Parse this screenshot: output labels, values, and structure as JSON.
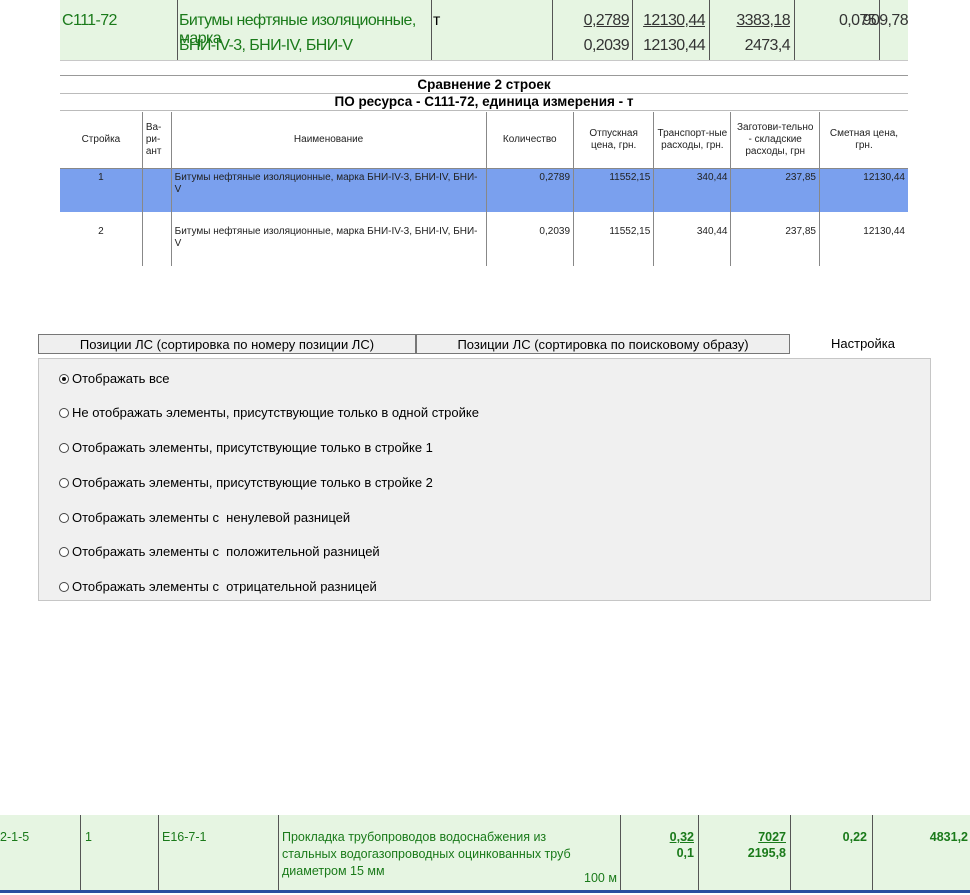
{
  "top_row": {
    "code": "С111-72",
    "name_line1": "Битумы нефтяные изоляционные, марка",
    "name_line2": "БНИ-IV-3, БНИ-IV, БНИ-V",
    "unit": "т",
    "qty1": "0,2789",
    "qty2": "0,2039",
    "price1": "12130,44",
    "price2": "12130,44",
    "sum1": "3383,18",
    "sum2": "2473,4",
    "diff": "0,075",
    "diff_sum": "909,78"
  },
  "comparison": {
    "title": "Сравнение 2 строек",
    "subtitle": "ПО ресурса - С111-72, единица измерения - т",
    "headers": {
      "stroyka": "Стройка",
      "variant": "Ва-\nри-\nант",
      "name": "Наименование",
      "qty": "Количество",
      "release_price": "Отпускная цена, грн.",
      "transport": "Транспорт-ные расходы, грн.",
      "storage": "Заготови-тельно - складские расходы, грн",
      "estimate": "Сметная цена, грн."
    },
    "rows": [
      {
        "stroyka": "1",
        "variant": "",
        "name": "Битумы нефтяные изоляционные, марка БНИ-IV-3, БНИ-IV, БНИ-V",
        "qty": "0,2789",
        "release_price": "11552,15",
        "transport": "340,44",
        "storage": "237,85",
        "estimate": "12130,44",
        "selected": true
      },
      {
        "stroyka": "2",
        "variant": "",
        "name": "Битумы нефтяные изоляционные, марка БНИ-IV-3, БНИ-IV, БНИ-V",
        "qty": "0,2039",
        "release_price": "11552,15",
        "transport": "340,44",
        "storage": "237,85",
        "estimate": "12130,44",
        "selected": false
      }
    ]
  },
  "tabs": {
    "tab1": "Позиции ЛС (сортировка по номеру позиции ЛС)",
    "tab2": "Позиции ЛС (сортировка по поисковому образу)",
    "tab3": "Настройка"
  },
  "options": [
    {
      "label": "Отображать все",
      "checked": true
    },
    {
      "label": "Не отображать элементы, присутствующие только в одной стройке",
      "checked": false
    },
    {
      "label": "Отображать элементы, присутствующие только в стройке 1",
      "checked": false
    },
    {
      "label": "Отображать элементы, присутствующие только в стройке 2",
      "checked": false
    },
    {
      "label": "Отображать элементы с  ненулевой разницей",
      "checked": false
    },
    {
      "label": "Отображать элементы с  положительной разницей",
      "checked": false
    },
    {
      "label": "Отображать элементы с  отрицательной разницей",
      "checked": false
    }
  ],
  "bottom_row": {
    "position": "2-1-5",
    "number": "1",
    "code": "Е16-7-1",
    "name_line1": "Прокладка трубопроводов водоснабжения из",
    "name_line2": "стальных водогазопроводных оцинкованных труб",
    "name_line3": "диаметром 15 мм",
    "unit": "100 м",
    "qty1": "0,32",
    "qty2": "0,1",
    "price1": "7027",
    "price2": "2195,8",
    "diff": "0,22",
    "diff_sum": "4831,2"
  },
  "colors": {
    "row_bg": "#e6f5e2",
    "green_text": "#1a7a1a",
    "selection": "#7aa0ee",
    "panel_bg": "#f0f0f0",
    "bottom_border": "#2a4ea0"
  }
}
